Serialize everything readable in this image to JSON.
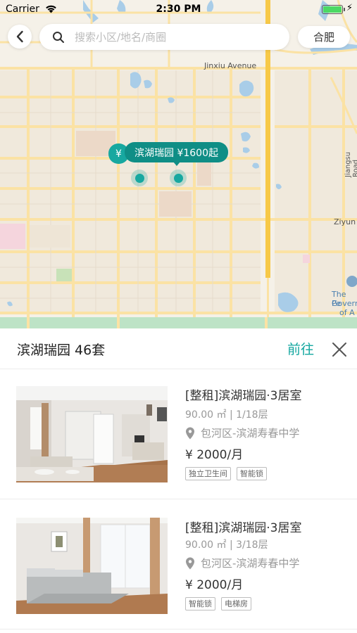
{
  "status_bar": {
    "carrier": "Carrier",
    "time": "2:30 PM"
  },
  "search": {
    "placeholder": "搜索小区/地名/商圈",
    "value": ""
  },
  "city_button": "合肥",
  "map": {
    "labels": {
      "jinxiu": "Jinxiu Avenue",
      "jiangsu": "Jiangsu Road",
      "ziyun": "Ziyun",
      "gov_1": "The Pe",
      "gov_2": "Govern",
      "gov_3": "of A"
    },
    "marker_back": "¥",
    "marker_main": "滨湖瑞园 ¥1600起"
  },
  "panel": {
    "title": "滨湖瑞园 46套",
    "goto": "前往"
  },
  "listings": [
    {
      "title": "[整租]滨湖瑞园·3居室",
      "meta": "90.00 ㎡ | 1/18层",
      "location": "包河区-滨湖寿春中学",
      "price": "¥ 2000/月",
      "tags": [
        "独立卫生间",
        "智能锁"
      ]
    },
    {
      "title": "[整租]滨湖瑞园·3居室",
      "meta": "90.00 ㎡ | 3/18层",
      "location": "包河区-滨湖寿春中学",
      "price": "¥ 2000/月",
      "tags": [
        "智能锁",
        "电梯房"
      ]
    }
  ],
  "colors": {
    "accent": "#14a7a0",
    "marker": "#0f8e86",
    "map_bg": "#f5f1e8",
    "road_major": "#f7c948"
  }
}
